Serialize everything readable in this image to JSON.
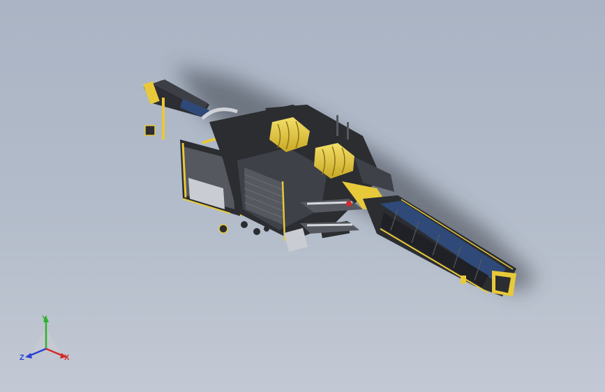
{
  "viewport": {
    "background_top": "#aab4c4",
    "background_bottom": "#c3c9d4"
  },
  "model": {
    "name": "",
    "colors": {
      "body_dark": "#2b2d31",
      "body_mid": "#4a4d54",
      "accent_yellow": "#e8c93a",
      "conveyor_blue": "#2f4a78",
      "shadow": "#5a6170"
    }
  },
  "triad": {
    "x_label": "X",
    "y_label": "Y",
    "z_label": "Z",
    "x_color": "#d42a2a",
    "y_color": "#2fb22f",
    "z_color": "#2a3fd4"
  }
}
